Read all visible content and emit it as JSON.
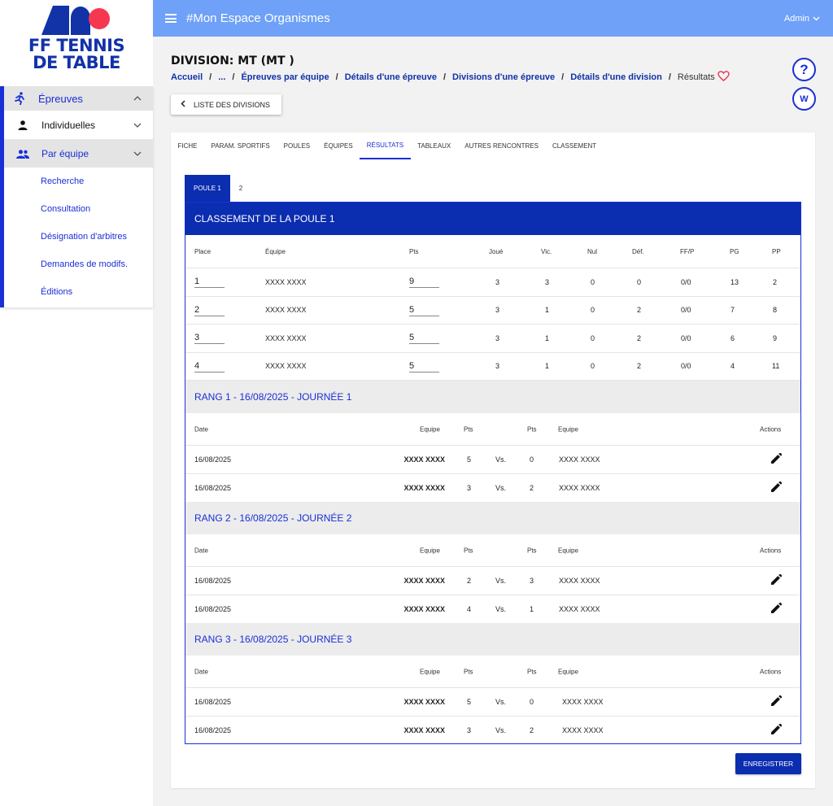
{
  "logo": {
    "line1": "FF TENNIS",
    "line2": "DE TABLE"
  },
  "topbar": {
    "title": "#Mon Espace Organismes",
    "user": "Admin"
  },
  "sidebar": {
    "section": "Épreuves",
    "individuelles": "Individuelles",
    "par_equipe": "Par équipe",
    "items": [
      "Recherche",
      "Consultation",
      "Désignation d'arbitres",
      "Demandes de modifs.",
      "Éditions"
    ]
  },
  "header": {
    "division_title": "DIVISION: MT (MT )",
    "breadcrumb": [
      "Accueil",
      "...",
      "Épreuves par équipe",
      "Détails d'une épreuve",
      "Divisions d'une épreuve",
      "Détails d'une division"
    ],
    "breadcrumb_current": "Résultats",
    "help_label": "?",
    "w_label": "W",
    "list_button": "LISTE DES DIVISIONS"
  },
  "tabs": [
    "FICHE",
    "PARAM. SPORTIFS",
    "POULES",
    "ÉQUIPES",
    "RÉSULTATS",
    "TABLEAUX",
    "AUTRES RENCONTRES",
    "CLASSEMENT"
  ],
  "active_tab": "RÉSULTATS",
  "poule_tabs": [
    "POULE 1",
    "2"
  ],
  "classement": {
    "title": "CLASSEMENT DE LA POULE 1",
    "headers": [
      "Place",
      "Équipe",
      "Pts",
      "Joué",
      "Vic.",
      "Nul",
      "Déf.",
      "FF/P",
      "PG",
      "PP"
    ],
    "rows": [
      {
        "place": "1",
        "equipe": "XXXX XXXX",
        "pts": "9",
        "joue": "3",
        "vic": "3",
        "nul": "0",
        "def": "0",
        "ffp": "0/0",
        "pg": "13",
        "pp": "2"
      },
      {
        "place": "2",
        "equipe": "XXXX XXXX",
        "pts": "5",
        "joue": "3",
        "vic": "1",
        "nul": "0",
        "def": "2",
        "ffp": "0/0",
        "pg": "7",
        "pp": "8"
      },
      {
        "place": "3",
        "equipe": "XXXX XXXX",
        "pts": "5",
        "joue": "3",
        "vic": "1",
        "nul": "0",
        "def": "2",
        "ffp": "0/0",
        "pg": "6",
        "pp": "9"
      },
      {
        "place": "4",
        "equipe": "XXXX XXXX",
        "pts": "5",
        "joue": "3",
        "vic": "1",
        "nul": "0",
        "def": "2",
        "ffp": "0/0",
        "pg": "4",
        "pp": "11"
      }
    ]
  },
  "match_headers": {
    "date": "Date",
    "equipe1": "Equipe",
    "pts1": "Pts",
    "pts2": "Pts",
    "equipe2": "Equipe",
    "actions": "Actions"
  },
  "rangs": [
    {
      "title": "RANG 1 - 16/08/2025 - JOURNÉE 1",
      "matches": [
        {
          "date": "16/08/2025",
          "eq1": "XXXX XXXX",
          "pts1": "5",
          "vs": "Vs.",
          "pts2": "0",
          "eq2": "XXXX XXXX"
        },
        {
          "date": "16/08/2025",
          "eq1": "XXXX XXXX",
          "pts1": "3",
          "vs": "Vs.",
          "pts2": "2",
          "eq2": "XXXX XXXX"
        }
      ]
    },
    {
      "title": "RANG 2 - 16/08/2025 - JOURNÉE 2",
      "matches": [
        {
          "date": "16/08/2025",
          "eq1": "XXXX XXXX",
          "pts1": "2",
          "vs": "Vs.",
          "pts2": "3",
          "eq2": "XXXX XXXX"
        },
        {
          "date": "16/08/2025",
          "eq1": "XXXX XXXX",
          "pts1": "4",
          "vs": "Vs.",
          "pts2": "1",
          "eq2": "XXXX XXXX"
        }
      ]
    },
    {
      "title": "RANG 3 - 16/08/2025 - JOURNÉE 3",
      "matches": [
        {
          "date": "16/08/2025",
          "eq1": "XXXX XXXX",
          "pts1": "5",
          "vs": "Vs.",
          "pts2": "0",
          "eq2": "XXXX XXXX"
        },
        {
          "date": "16/08/2025",
          "eq1": "XXXX XXXX",
          "pts1": "3",
          "vs": "Vs.",
          "pts2": "2",
          "eq2": "XXXX XXXX"
        }
      ]
    }
  ],
  "save_button": "ENREGISTRER",
  "colors": {
    "primary": "#0b2db0",
    "topbar": "#6ea1f7",
    "accent": "#1a2fd6",
    "logo_red": "#f5384f"
  },
  "icons": {
    "menu": "hamburger-icon",
    "run": "running-icon",
    "person": "person-icon",
    "group": "group-icon",
    "edit": "pencil-icon",
    "heart": "heart-icon"
  }
}
